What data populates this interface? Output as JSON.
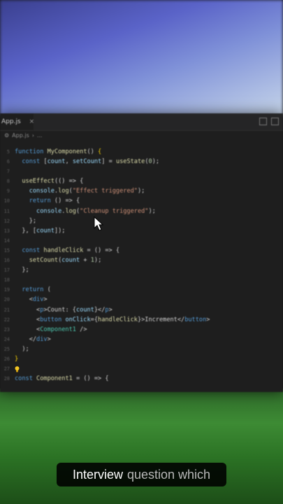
{
  "editor": {
    "tab_label": "App.js",
    "tab_close": "×",
    "breadcrumb": [
      "App.js",
      "..."
    ],
    "lines": [
      {
        "n": "5",
        "segs": [
          [
            "kw",
            "function "
          ],
          [
            "fn",
            "MyComponent"
          ],
          [
            "pun",
            "() "
          ],
          [
            "brace",
            "{"
          ]
        ]
      },
      {
        "n": "6",
        "segs": [
          [
            "pun",
            "  "
          ],
          [
            "kw",
            "const "
          ],
          [
            "pun",
            "["
          ],
          [
            "var",
            "count"
          ],
          [
            "pun",
            ", "
          ],
          [
            "var",
            "setCount"
          ],
          [
            "pun",
            "] = "
          ],
          [
            "fn",
            "useState"
          ],
          [
            "pun",
            "("
          ],
          [
            "num",
            "0"
          ],
          [
            "pun",
            ");"
          ]
        ]
      },
      {
        "n": "7",
        "segs": []
      },
      {
        "n": "8",
        "segs": [
          [
            "pun",
            "  "
          ],
          [
            "fn",
            "useEffect"
          ],
          [
            "pun",
            "(() => {"
          ]
        ]
      },
      {
        "n": "9",
        "segs": [
          [
            "pun",
            "    "
          ],
          [
            "var",
            "console"
          ],
          [
            "pun",
            "."
          ],
          [
            "fn",
            "log"
          ],
          [
            "pun",
            "("
          ],
          [
            "str",
            "\"Effect triggered\""
          ],
          [
            "pun",
            ");"
          ]
        ]
      },
      {
        "n": "10",
        "segs": [
          [
            "pun",
            "    "
          ],
          [
            "kw",
            "return "
          ],
          [
            "pun",
            "() => {"
          ]
        ]
      },
      {
        "n": "11",
        "segs": [
          [
            "pun",
            "      "
          ],
          [
            "var",
            "console"
          ],
          [
            "pun",
            "."
          ],
          [
            "fn",
            "log"
          ],
          [
            "pun",
            "("
          ],
          [
            "str",
            "\"Cleanup triggered\""
          ],
          [
            "pun",
            ");"
          ]
        ]
      },
      {
        "n": "12",
        "segs": [
          [
            "pun",
            "    };"
          ]
        ]
      },
      {
        "n": "13",
        "segs": [
          [
            "pun",
            "  }, ["
          ],
          [
            "var",
            "count"
          ],
          [
            "pun",
            "]);"
          ]
        ]
      },
      {
        "n": "14",
        "segs": []
      },
      {
        "n": "15",
        "segs": [
          [
            "pun",
            "  "
          ],
          [
            "kw",
            "const "
          ],
          [
            "fn",
            "handleClick"
          ],
          [
            "pun",
            " = () => {"
          ]
        ]
      },
      {
        "n": "16",
        "segs": [
          [
            "pun",
            "    "
          ],
          [
            "fn",
            "setCount"
          ],
          [
            "pun",
            "("
          ],
          [
            "var",
            "count"
          ],
          [
            "pun",
            " + "
          ],
          [
            "num",
            "1"
          ],
          [
            "pun",
            ");"
          ]
        ]
      },
      {
        "n": "17",
        "segs": [
          [
            "pun",
            "  };"
          ]
        ]
      },
      {
        "n": "18",
        "segs": []
      },
      {
        "n": "19",
        "segs": [
          [
            "pun",
            "  "
          ],
          [
            "kw",
            "return "
          ],
          [
            "pun",
            "("
          ]
        ]
      },
      {
        "n": "20",
        "segs": [
          [
            "pun",
            "    <"
          ],
          [
            "tag",
            "div"
          ],
          [
            "pun",
            ">"
          ]
        ]
      },
      {
        "n": "21",
        "segs": [
          [
            "pun",
            "      <"
          ],
          [
            "tag",
            "p"
          ],
          [
            "pun",
            ">Count: {"
          ],
          [
            "var",
            "count"
          ],
          [
            "pun",
            "}</"
          ],
          [
            "tag",
            "p"
          ],
          [
            "pun",
            ">"
          ]
        ]
      },
      {
        "n": "22",
        "segs": [
          [
            "pun",
            "      <"
          ],
          [
            "tag",
            "button "
          ],
          [
            "var",
            "onClick"
          ],
          [
            "pun",
            "={"
          ],
          [
            "fn",
            "handleClick"
          ],
          [
            "pun",
            "}>Increment</"
          ],
          [
            "tag",
            "button"
          ],
          [
            "pun",
            ">"
          ]
        ]
      },
      {
        "n": "23",
        "segs": [
          [
            "pun",
            "      <"
          ],
          [
            "cmp",
            "Component1"
          ],
          [
            "pun",
            " />"
          ]
        ]
      },
      {
        "n": "24",
        "segs": [
          [
            "pun",
            "    </"
          ],
          [
            "tag",
            "div"
          ],
          [
            "pun",
            ">"
          ]
        ]
      },
      {
        "n": "25",
        "segs": [
          [
            "pun",
            "  );"
          ]
        ]
      },
      {
        "n": "26",
        "segs": [
          [
            "brace",
            "}"
          ]
        ]
      },
      {
        "n": "27",
        "segs": []
      },
      {
        "n": "28",
        "segs": [
          [
            "kw",
            "const "
          ],
          [
            "fn",
            "Component1"
          ],
          [
            "pun",
            " = () => {"
          ]
        ]
      }
    ]
  },
  "caption": {
    "highlight": "Interview",
    "rest": "question which"
  },
  "colors": {
    "editor_bg": "#1e1e1e",
    "keyword": "#569cd6",
    "function": "#dcdcaa",
    "string": "#ce9178"
  }
}
